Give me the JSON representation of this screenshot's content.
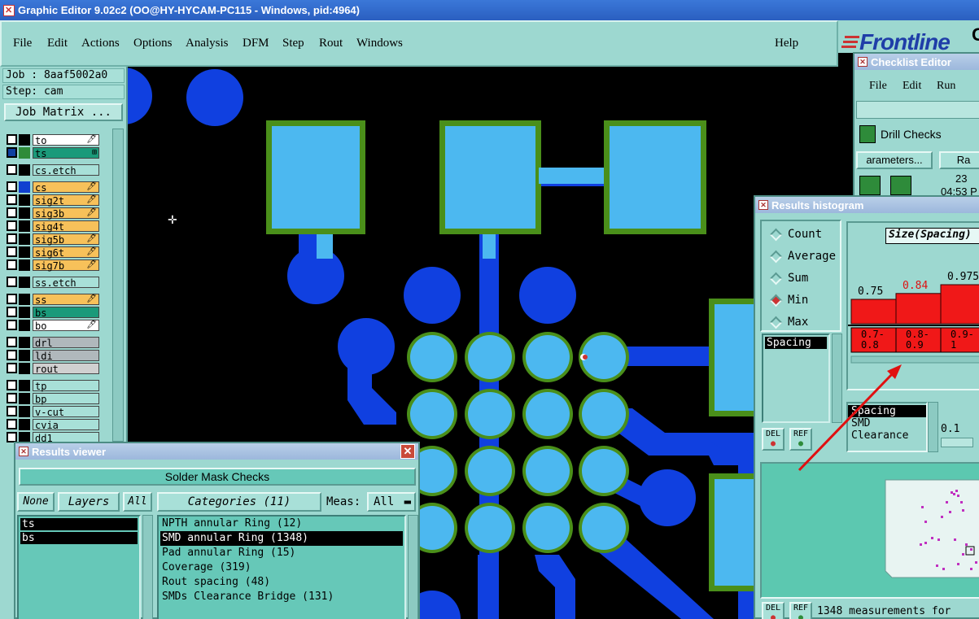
{
  "window": {
    "title": "Graphic Editor 9.02c2 (OO@HY-HYCAM-PC115 - Windows, pid:4964)"
  },
  "menubar": {
    "items": [
      "File",
      "Edit",
      "Actions",
      "Options",
      "Analysis",
      "DFM",
      "Step",
      "Rout",
      "Windows"
    ],
    "help": "Help"
  },
  "brand": {
    "logo": "Frontline",
    "logo_tail": "C"
  },
  "job": {
    "job_label": "Job : 8aaf5002a0",
    "step_label": "Step: cam",
    "matrix_button": "Job Matrix ..."
  },
  "layers": [
    {
      "name": "to",
      "color": "#ffffff",
      "swatch": "#000000",
      "tag": "🖊"
    },
    {
      "name": "ts",
      "color": "#1a9a7a",
      "swatch": "#2e8b3a",
      "tag": "⊞",
      "active": true
    },
    {
      "name": "cs.etch",
      "color": "#a8e0d8",
      "swatch": "#000000",
      "tag": ""
    },
    {
      "name": "cs",
      "color": "#f7c15a",
      "swatch": "#1040d0",
      "tag": "🖊"
    },
    {
      "name": "sig2t",
      "color": "#f7c15a",
      "swatch": "#000000",
      "tag": "🖊"
    },
    {
      "name": "sig3b",
      "color": "#f7c15a",
      "swatch": "#000000",
      "tag": "🖊"
    },
    {
      "name": "sig4t",
      "color": "#f7c15a",
      "swatch": "#000000",
      "tag": ""
    },
    {
      "name": "sig5b",
      "color": "#f7c15a",
      "swatch": "#000000",
      "tag": "🖊"
    },
    {
      "name": "sig6t",
      "color": "#f7c15a",
      "swatch": "#000000",
      "tag": "🖊"
    },
    {
      "name": "sig7b",
      "color": "#f7c15a",
      "swatch": "#000000",
      "tag": "🖊"
    },
    {
      "name": "ss.etch",
      "color": "#a8e0d8",
      "swatch": "#000000",
      "tag": ""
    },
    {
      "name": "ss",
      "color": "#f7c15a",
      "swatch": "#000000",
      "tag": "🖊"
    },
    {
      "name": "bs",
      "color": "#1a9a7a",
      "swatch": "#000000",
      "tag": ""
    },
    {
      "name": "bo",
      "color": "#ffffff",
      "swatch": "#000000",
      "tag": "🖊"
    },
    {
      "name": "drl",
      "color": "#b0b8bc",
      "swatch": "#000000",
      "tag": ""
    },
    {
      "name": "ldi",
      "color": "#b0b8bc",
      "swatch": "#000000",
      "tag": ""
    },
    {
      "name": "rout",
      "color": "#d0d0d0",
      "swatch": "#000000",
      "tag": ""
    },
    {
      "name": "tp",
      "color": "#a8e0d8",
      "swatch": "#000000",
      "tag": ""
    },
    {
      "name": "bp",
      "color": "#a8e0d8",
      "swatch": "#000000",
      "tag": ""
    },
    {
      "name": "v-cut",
      "color": "#a8e0d8",
      "swatch": "#000000",
      "tag": ""
    },
    {
      "name": "cvia",
      "color": "#a8e0d8",
      "swatch": "#000000",
      "tag": ""
    },
    {
      "name": "dd1",
      "color": "#a8e0d8",
      "swatch": "#000000",
      "tag": ""
    }
  ],
  "checklist": {
    "title": "Checklist Editor",
    "menus": [
      "File",
      "Edit",
      "Run"
    ],
    "item": "Drill Checks",
    "params_button": "arameters...",
    "ra_button": "Ra",
    "count": "23",
    "time": "04:53 P"
  },
  "histogram": {
    "title": "Results histogram",
    "modes": [
      "Count",
      "Average",
      "Sum",
      "Min",
      "Max"
    ],
    "selected_mode": "Min",
    "header": "Size(Spacing)",
    "metric_list": [
      "Spacing"
    ],
    "types": [
      "Spacing",
      "SMD",
      "Clearance"
    ],
    "threshold": "0.1",
    "del": "DEL",
    "ref": "REF",
    "footer": "1348 measurements for",
    "bars": [
      {
        "label": "0.75",
        "bin": "0.7-\n0.8",
        "value": 0.75
      },
      {
        "label": "0.84",
        "bin": "0.8-\n0.9",
        "value": 0.84
      },
      {
        "label": "0.975",
        "bin": "0.9-\n1",
        "value": 0.975
      }
    ]
  },
  "results_viewer": {
    "title": "Results viewer",
    "header": "Solder Mask Checks",
    "none_button": "None",
    "layers_button": "Layers",
    "all_button": "All",
    "categories_button": "Categories (11)",
    "meas_label": "Meas:",
    "meas_value": "All",
    "layers": [
      "ts",
      "bs"
    ],
    "categories": [
      "NPTH annular Ring (12)",
      "SMD annular Ring (1348)",
      "Pad annular Ring (15)",
      "Coverage (319)",
      "Rout spacing (48)",
      "SMDs Clearance Bridge (131)"
    ],
    "selected_category": "SMD annular Ring (1348)"
  }
}
